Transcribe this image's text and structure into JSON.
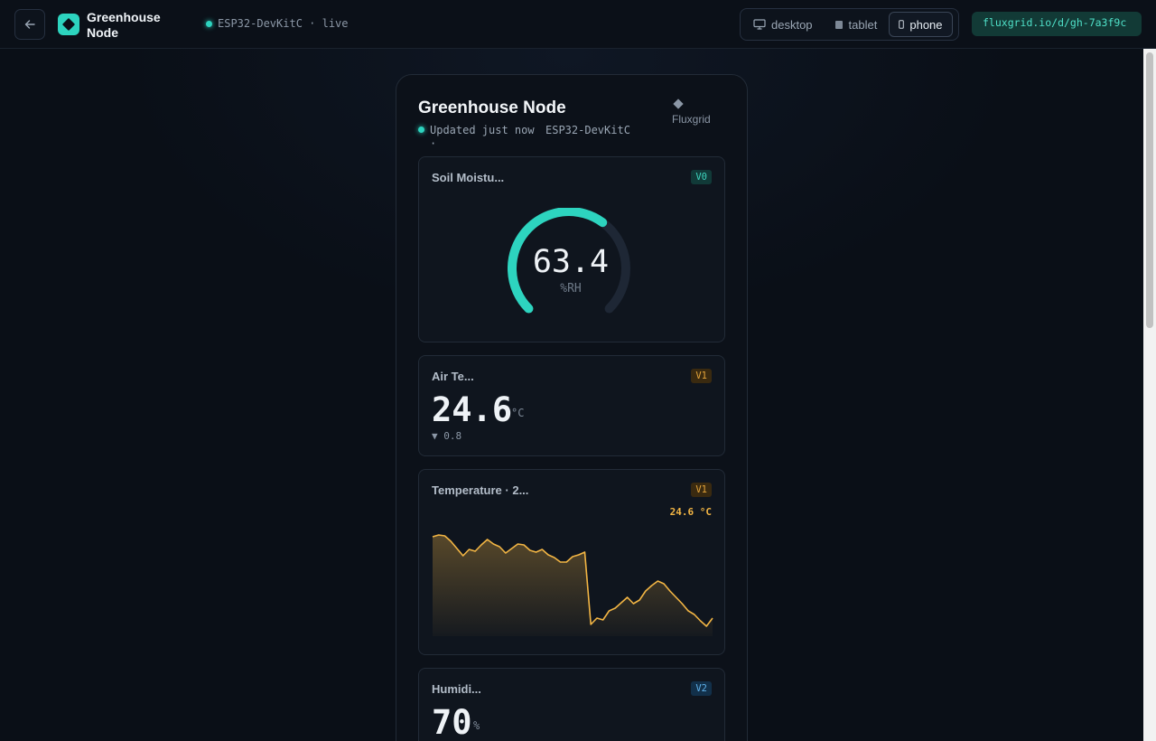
{
  "app": {
    "title": "Greenhouse Node",
    "device_status": "ESP32-DevKitC · live"
  },
  "view_modes": {
    "options": [
      "desktop",
      "tablet",
      "phone"
    ],
    "selected": "phone"
  },
  "share": {
    "url": "fluxgrid.io/d/gh-7a3f9c"
  },
  "phone": {
    "title": "Greenhouse Node",
    "updated": "Updated just now ·",
    "device": "ESP32-DevKitC",
    "brand": "Fluxgrid"
  },
  "widgets": {
    "soil": {
      "label": "Soil Moistu...",
      "pin": "V0",
      "value": "63.4",
      "unit": "%RH",
      "fill_fraction": 0.634
    },
    "air": {
      "label": "Air Te...",
      "pin": "V1",
      "value": "24.6",
      "unit": "°C",
      "delta": "▼ 0.8"
    },
    "temp_chart": {
      "label": "Temperature · 2...",
      "pin": "V1",
      "current": "24.6 °C"
    },
    "humidity": {
      "label": "Humidi...",
      "pin": "V2",
      "value": "70",
      "unit": "%"
    }
  },
  "chart_data": {
    "type": "area",
    "title": "",
    "xlabel": "",
    "ylabel": "",
    "ylim": [
      18,
      31
    ],
    "grid": false,
    "series": [
      {
        "values": [
          29.2,
          29.4,
          29.3,
          28.7,
          27.9,
          27.1,
          27.8,
          27.6,
          28.3,
          28.9,
          28.4,
          28.1,
          27.4,
          27.9,
          28.4,
          28.3,
          27.7,
          27.5,
          27.8,
          27.2,
          26.9,
          26.4,
          26.4,
          27.0,
          27.2,
          27.5,
          19.5,
          20.2,
          20.0,
          21.0,
          21.3,
          21.9,
          22.5,
          21.8,
          22.2,
          23.2,
          23.8,
          24.3,
          24.0,
          23.2,
          22.5,
          21.8,
          21.0,
          20.6,
          19.9,
          19.3,
          20.2
        ]
      }
    ]
  },
  "colors": {
    "accent": "#2dd4bf",
    "chart_line": "#f2b544",
    "gauge_track": "#1e2735"
  }
}
